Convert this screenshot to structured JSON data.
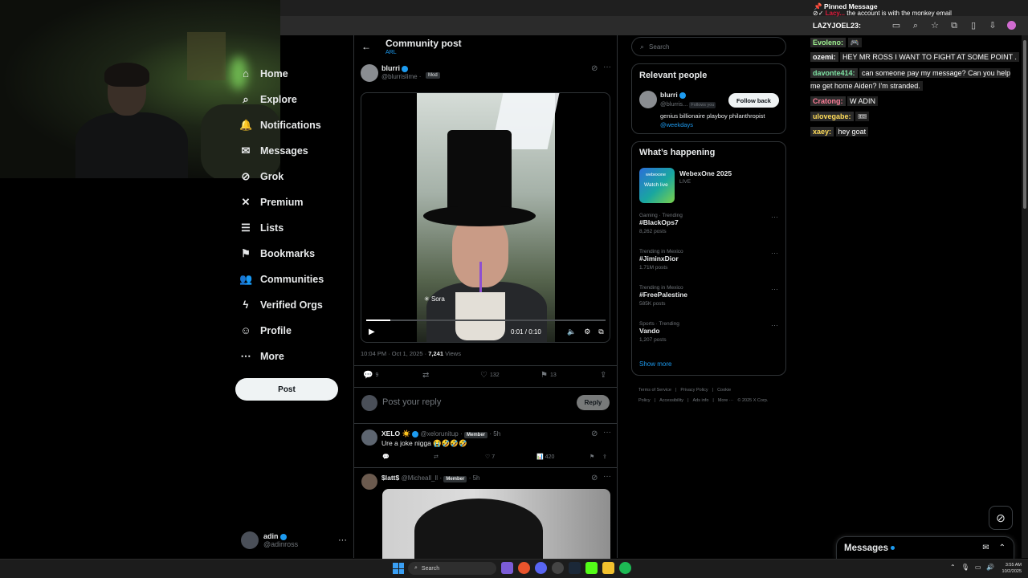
{
  "webcam": {
    "label": "streamer webcam"
  },
  "nav": {
    "items": [
      {
        "label": "Home",
        "icon": "home-icon",
        "glyph": "⌂"
      },
      {
        "label": "Explore",
        "icon": "search-icon",
        "glyph": "⌕"
      },
      {
        "label": "Notifications",
        "icon": "bell-icon",
        "glyph": "🔔"
      },
      {
        "label": "Messages",
        "icon": "mail-icon",
        "glyph": "✉"
      },
      {
        "label": "Grok",
        "icon": "grok-icon",
        "glyph": "⊘"
      },
      {
        "label": "Premium",
        "icon": "x-icon",
        "glyph": "✕"
      },
      {
        "label": "Lists",
        "icon": "list-icon",
        "glyph": "☰"
      },
      {
        "label": "Bookmarks",
        "icon": "bookmark-icon",
        "glyph": "⚑"
      },
      {
        "label": "Communities",
        "icon": "people-icon",
        "glyph": "👥"
      },
      {
        "label": "Verified Orgs",
        "icon": "lightning-icon",
        "glyph": "ϟ"
      },
      {
        "label": "Profile",
        "icon": "person-icon",
        "glyph": "☺"
      },
      {
        "label": "More",
        "icon": "more-circle-icon",
        "glyph": "⋯"
      }
    ],
    "post_label": "Post",
    "me_name": "adin",
    "me_handle": "@adinross"
  },
  "header": {
    "title": "Community post",
    "subtitle": "ARL",
    "back_glyph": "←"
  },
  "post": {
    "author": "blurri",
    "handle": "@blurrislime",
    "badge": "Mod",
    "sora_label": "Sora",
    "time_label": "0:01 / 0:10",
    "progress": 0.1,
    "meta_time": "10:04 PM · Oct 1, 2025 ·",
    "views_count": "7,241",
    "views_label": "Views",
    "replies": "9",
    "likes": "132",
    "bookmarks": "13"
  },
  "reply_box": {
    "placeholder": "Post your reply",
    "button": "Reply"
  },
  "comments": [
    {
      "name": "XELO ☀️",
      "handle": "@xelorunitup",
      "badge": "Member",
      "age": "· 5h",
      "text": "Ure a joke nigga 😭🤣🤣🤣",
      "likes": "7",
      "views": "420"
    },
    {
      "name": "$latt$",
      "handle": "@Micheall_ll",
      "badge": "Member",
      "age": "· 5h"
    }
  ],
  "right": {
    "search_placeholder": "Search",
    "relevant_title": "Relevant people",
    "person_name": "blurri",
    "person_handle": "@blurris...",
    "follows_you": "Follows you",
    "follow_button": "Follow back",
    "bio_text": "genius billionaire playboy philanthropist ",
    "bio_link": "@weekdays",
    "happening_title": "What’s happening",
    "event_name": "WebexOne 2025",
    "event_status": "LIVE",
    "event_img_brand": "webexone",
    "event_img_text": "Watch live",
    "trends": [
      {
        "meta": "Gaming · Trending",
        "name": "#BlackOps7",
        "count": "8,262 posts"
      },
      {
        "meta": "Trending in Mexico",
        "name": "#JiminxDior",
        "count": "1.71M posts"
      },
      {
        "meta": "Trending in Mexico",
        "name": "#FreePalestine",
        "count": "585K posts"
      },
      {
        "meta": "Sports · Trending",
        "name": "Vando",
        "count": "1,207 posts"
      }
    ],
    "show_more": "Show more",
    "footer": [
      "Terms of Service",
      "|",
      "Privacy Policy",
      "|",
      "Cookie Policy",
      "|",
      "Accessibility",
      "|",
      "Ads info",
      "|",
      "More ···",
      "© 2025 X Corp."
    ]
  },
  "chat": {
    "pinned_title": "Pinned Message",
    "pinned_user": "Lacy...",
    "pinned_text": "the account is with the monkey email",
    "pinned_author": "LAZYJOEL23:",
    "lines": [
      {
        "user": "Evoleno:",
        "msg": "🎮",
        "color": "#9ef08f"
      },
      {
        "user": "ozemi:",
        "msg": "HEY MR ROSS I WANT TO FIGHT AT SOME POINT .",
        "color": "#ffffff"
      },
      {
        "user": "davonte414:",
        "msg": "can someone pay my message? Can you help me get home Aiden? I'm stranded.",
        "color": "#7fe3a4"
      },
      {
        "user": "Cratong:",
        "msg": "W ADIN",
        "color": "#ff7f9a"
      },
      {
        "user": "ulovegabe:",
        "msg": "🎟",
        "color": "#ffdc5a"
      },
      {
        "user": "xaey:",
        "msg": "hey goat",
        "color": "#ffdc5a"
      }
    ]
  },
  "messages_drawer": {
    "title": "Messages"
  },
  "taskbar": {
    "search": "Search",
    "time": "3:55 AM",
    "date": "10/2/2025"
  }
}
